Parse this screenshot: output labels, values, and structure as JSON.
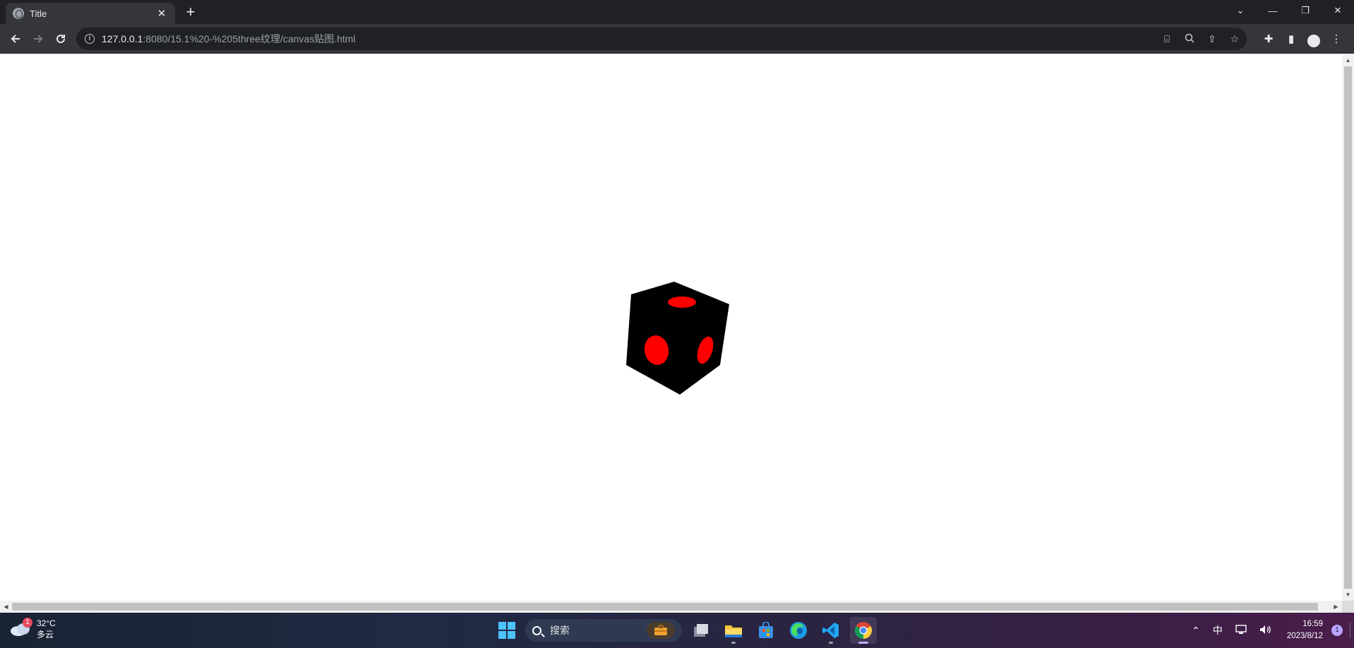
{
  "browser": {
    "tab": {
      "title": "Title"
    },
    "url": {
      "host": "127.0.0.1",
      "rest": ":8080/15.1%20-%205three纹理/canvas贴图.html"
    }
  },
  "scene": {
    "cube_color": "#000000",
    "dot_color": "#ff0000",
    "background_color": "#ffffff"
  },
  "taskbar": {
    "weather": {
      "badge": "1",
      "temperature": "32°C",
      "condition": "多云"
    },
    "search": {
      "label": "搜索"
    },
    "tray": {
      "ime": "中",
      "time": "16:59",
      "date": "2023/8/12",
      "notification_count": "1"
    }
  },
  "colors": {
    "chrome_dark": "#202124",
    "chrome_toolbar": "#35363a",
    "accent_windows": "#0078d4"
  }
}
